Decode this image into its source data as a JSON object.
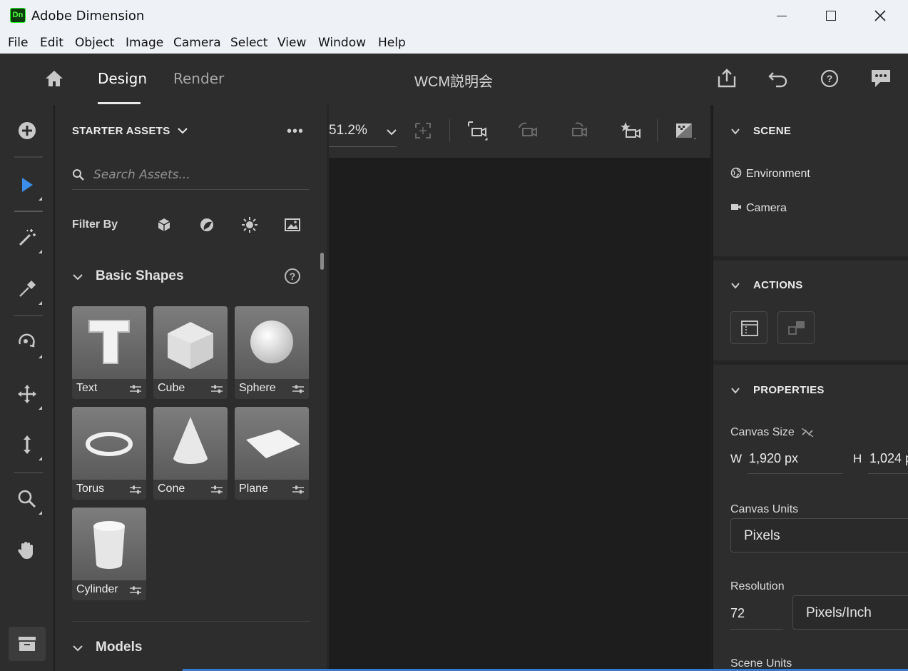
{
  "window": {
    "app_icon_text": "Dn",
    "title": "Adobe Dimension"
  },
  "menu": [
    "File",
    "Edit",
    "Object",
    "Image",
    "Camera",
    "Select",
    "View",
    "Window",
    "Help"
  ],
  "appbar": {
    "tabs": [
      "Design",
      "Render"
    ],
    "active_tab": "Design",
    "document_title": "WCM説明会"
  },
  "assets": {
    "title": "STARTER ASSETS",
    "search_placeholder": "Search Assets...",
    "filter_label": "Filter By",
    "sections": {
      "basic_shapes": "Basic Shapes",
      "models": "Models"
    },
    "shapes": [
      "Text",
      "Cube",
      "Sphere",
      "Torus",
      "Cone",
      "Plane",
      "Cylinder"
    ]
  },
  "viewport": {
    "zoom": "51.2%"
  },
  "right_panel": {
    "scene": {
      "title": "SCENE",
      "items": [
        "Environment",
        "Camera"
      ]
    },
    "actions": {
      "title": "ACTIONS"
    },
    "properties": {
      "title": "PROPERTIES",
      "canvas_size_label": "Canvas Size",
      "width_label": "W",
      "width_value": "1,920 px",
      "height_label": "H",
      "height_value": "1,024 p",
      "canvas_units_label": "Canvas Units",
      "canvas_units_value": "Pixels",
      "resolution_label": "Resolution",
      "resolution_value": "72",
      "resolution_unit": "Pixels/Inch",
      "scene_units_label": "Scene Units"
    }
  },
  "colors": {
    "panel": "#2d2d2d",
    "canvas": "#1d1d1d",
    "accent": "#2c8cf2"
  }
}
